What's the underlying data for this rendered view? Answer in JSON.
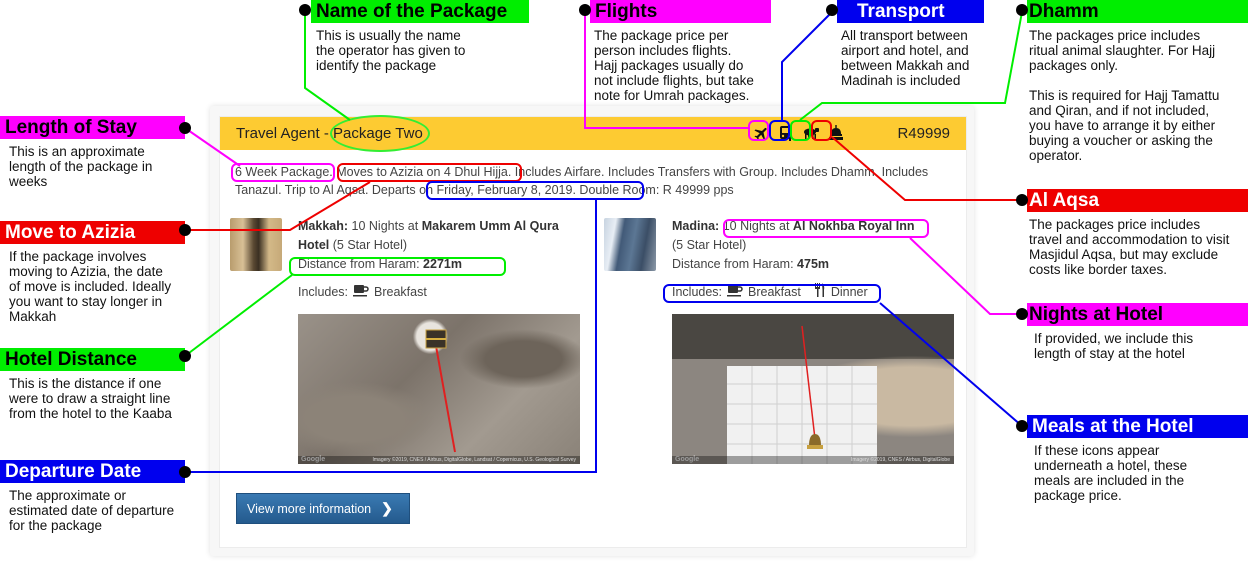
{
  "card": {
    "header": {
      "agent": "Travel Agent - ",
      "package_name": "Package Two",
      "price": "R49999",
      "inclusion_icons": [
        {
          "name": "flight-icon",
          "glyph": "✈"
        },
        {
          "name": "bus-icon",
          "glyph": "🚌"
        },
        {
          "name": "sheep-icon",
          "glyph": "🐑"
        },
        {
          "name": "mosque-dome-icon",
          "glyph": "🕌"
        }
      ]
    },
    "summary": {
      "length": "6 Week Package.",
      "azizia": "Moves to Azizia on 4 Dhul Hijja.",
      "includes": " Includes Airfare. Includes Transfers with Group. Includes Dhamm. Includes Tanazul. Trip to Al Aqsa. ",
      "departure": "Departs on Friday, February 8, 2019.",
      "room": " Double Room: R 49999 pps"
    },
    "hotels": [
      {
        "city": "Makkah:",
        "nights": "10 Nights at",
        "hotel_name": "Makarem Umm Al Qura Hotel",
        "stars": "(5 Star Hotel)",
        "distance_label": "Distance from Haram:",
        "distance": "2271m",
        "includes_label": "Includes:",
        "meals": [
          {
            "icon": "coffee-cup-icon",
            "glyph": "☕",
            "label": "Breakfast"
          }
        ],
        "map_logo": "Google",
        "map_attribution": "Imagery ©2019, CNES / Airbus, DigitalGlobe, Landsat / Copernicus, U.S. Geological Survey"
      },
      {
        "city": "Madina:",
        "nights": "10 Nights at",
        "hotel_name": "Al Nokhba Royal Inn",
        "stars": "(5 Star Hotel)",
        "distance_label": "Distance from Haram:",
        "distance": "475m",
        "includes_label": "Includes:",
        "meals": [
          {
            "icon": "coffee-cup-icon",
            "glyph": "☕",
            "label": "Breakfast"
          },
          {
            "icon": "fork-knife-icon",
            "glyph": "🍴",
            "label": "Dinner"
          }
        ],
        "map_logo": "Google",
        "map_attribution": "Imagery ©2019, CNES / Airbus, DigitalGlobe"
      }
    ],
    "more_button": "View more information",
    "more_chevron": "❯"
  },
  "callouts": {
    "name": {
      "title": "Name of the Package",
      "desc": "This is usually the name\nthe operator has given to\nidentify the package",
      "color": "#00ee00"
    },
    "flights": {
      "title": "Flights",
      "desc": "The package price per\nperson includes flights.\nHajj packages usually do\nnot include flights, but take\nnote for Umrah packages.",
      "color": "#ff00ff"
    },
    "transport": {
      "title": "Transport",
      "desc": "All transport between\nairport and hotel, and\nbetween Makkah and\nMadinah is included",
      "color": "#0000ee"
    },
    "dhamm": {
      "title": "Dhamm",
      "desc": "The packages price includes\nritual animal slaughter. For Hajj\npackages only.\n\nThis is required for Hajj Tamattu\nand Qiran, and if not included,\nyou have to arrange it by either\nbuying a voucher or asking the\noperator.",
      "color": "#00ee00"
    },
    "length": {
      "title": "Length of Stay",
      "desc": "This is an approximate\nlength of the package in\nweeks",
      "color": "#ff00ff"
    },
    "azizia": {
      "title": "Move to Azizia",
      "desc": "If the package involves\nmoving to Azizia, the date\nof move is included. Ideally\nyou want to stay longer in\nMakkah",
      "color": "#ee0000"
    },
    "distance": {
      "title": "Hotel Distance",
      "desc": "This is the distance if one\nwere to draw a straight line\nfrom the hotel to the Kaaba",
      "color": "#00ee00"
    },
    "departure": {
      "title": "Departure Date",
      "desc": "The approximate or\nestimated date of departure\nfor the package",
      "color": "#0000ee"
    },
    "aqsa": {
      "title": "Al Aqsa",
      "desc": "The packages price includes\ntravel and accommodation to visit\nMasjidul Aqsa, but may exclude\ncosts like border taxes.",
      "color": "#ee0000"
    },
    "nights": {
      "title": "Nights at Hotel",
      "desc": "If provided, we include this\nlength of stay at the hotel",
      "color": "#ff00ff"
    },
    "meals": {
      "title": "Meals at the Hotel",
      "desc": "If these icons appear\nunderneath a hotel, these\nmeals are included in the\npackage price.",
      "color": "#0000ee"
    }
  }
}
